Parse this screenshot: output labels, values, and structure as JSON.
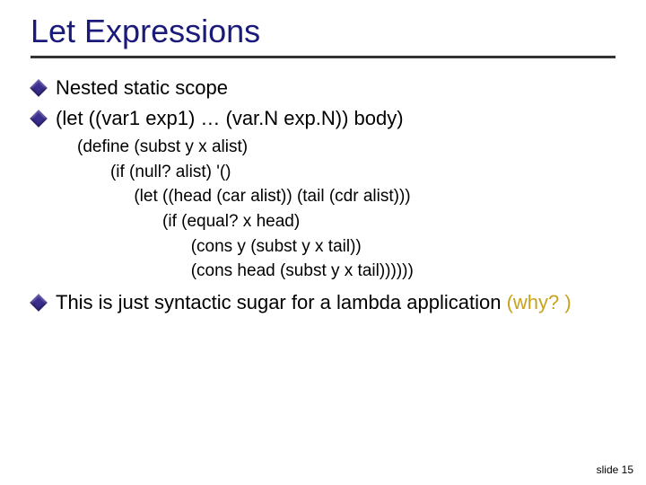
{
  "title": "Let Expressions",
  "bullets": {
    "nested": "Nested static scope",
    "let": "(let ((var1 exp1) … (var.N exp.N)) body)",
    "sugar": "This is just syntactic sugar for a lambda application ",
    "why": "(why? )"
  },
  "code": {
    "l1": "(define (subst y x alist)",
    "l2": "       (if (null? alist) '()",
    "l3": "            (let ((head (car alist)) (tail (cdr alist)))",
    "l4": "                  (if (equal? x head)",
    "l5": "                        (cons y (subst y x tail))",
    "l6": "                        (cons head (subst y x tail))))))"
  },
  "footer": "slide 15"
}
